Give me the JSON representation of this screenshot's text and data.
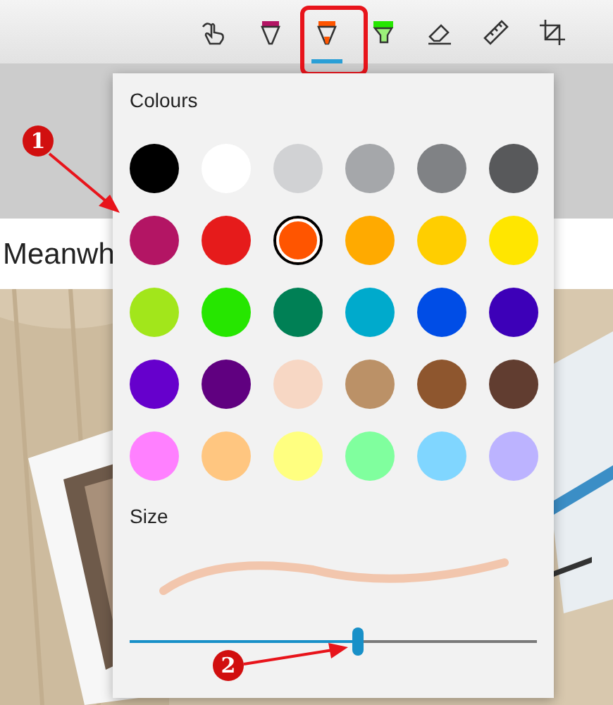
{
  "toolbar": {
    "tools": [
      {
        "kind": "touch",
        "selected": false
      },
      {
        "kind": "pen",
        "selected": false
      },
      {
        "kind": "pencil",
        "selected": true
      },
      {
        "kind": "highlighter",
        "selected": false
      },
      {
        "kind": "eraser",
        "selected": false
      },
      {
        "kind": "ruler",
        "selected": false
      },
      {
        "kind": "crop",
        "selected": false
      }
    ]
  },
  "document": {
    "text": "Meanwh"
  },
  "popup": {
    "colours_label": "Colours",
    "swatches": [
      {
        "color": "#000000",
        "selected": false
      },
      {
        "color": "#ffffff",
        "selected": false
      },
      {
        "color": "#d1d2d4",
        "selected": false
      },
      {
        "color": "#a5a7aa",
        "selected": false
      },
      {
        "color": "#808285",
        "selected": false
      },
      {
        "color": "#58595b",
        "selected": false
      },
      {
        "color": "#b31564",
        "selected": false
      },
      {
        "color": "#e61b1b",
        "selected": false
      },
      {
        "color": "#ff5500",
        "selected": true
      },
      {
        "color": "#ffaa00",
        "selected": false
      },
      {
        "color": "#ffce00",
        "selected": false
      },
      {
        "color": "#ffe600",
        "selected": false
      },
      {
        "color": "#a2e61b",
        "selected": false
      },
      {
        "color": "#26e600",
        "selected": false
      },
      {
        "color": "#008055",
        "selected": false
      },
      {
        "color": "#00aacc",
        "selected": false
      },
      {
        "color": "#004de6",
        "selected": false
      },
      {
        "color": "#3d00b8",
        "selected": false
      },
      {
        "color": "#6600cc",
        "selected": false
      },
      {
        "color": "#600080",
        "selected": false
      },
      {
        "color": "#f7d7c4",
        "selected": false
      },
      {
        "color": "#bb9167",
        "selected": false
      },
      {
        "color": "#8e562e",
        "selected": false
      },
      {
        "color": "#613d30",
        "selected": false
      },
      {
        "color": "#ff80ff",
        "selected": false
      },
      {
        "color": "#ffc680",
        "selected": false
      },
      {
        "color": "#ffff80",
        "selected": false
      },
      {
        "color": "#80ff9e",
        "selected": false
      },
      {
        "color": "#80d6ff",
        "selected": false
      },
      {
        "color": "#bcb3ff",
        "selected": false
      }
    ],
    "size_label": "Size",
    "size": {
      "level": 0.56
    }
  },
  "annotations": [
    {
      "number": "1"
    },
    {
      "number": "2"
    }
  ]
}
